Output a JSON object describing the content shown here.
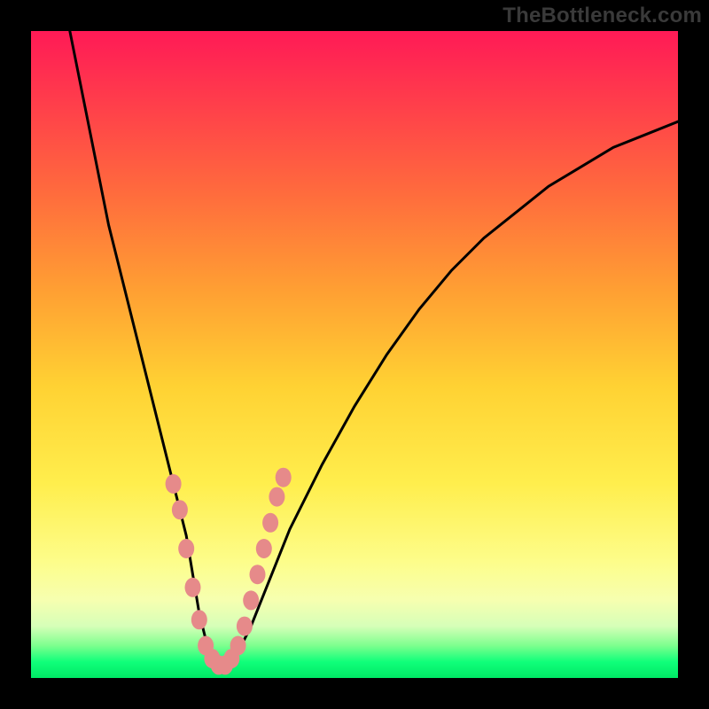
{
  "watermark": "TheBottleneck.com",
  "colors": {
    "background": "#000000",
    "curve": "#000000",
    "markers": "#e68a8a",
    "gradient_top": "#ff1a56",
    "gradient_bottom": "#00e865"
  },
  "chart_data": {
    "type": "line",
    "title": "",
    "xlabel": "",
    "ylabel": "",
    "xlim": [
      0,
      100
    ],
    "ylim": [
      0,
      100
    ],
    "grid": false,
    "legend": false,
    "note": "Axis values are relative percentages; image has no numeric tick labels.",
    "series": [
      {
        "name": "bottleneck-curve",
        "x": [
          6,
          8,
          10,
          12,
          15,
          18,
          20,
          22,
          24,
          25,
          26,
          27,
          28,
          29,
          30,
          32,
          34,
          36,
          38,
          40,
          45,
          50,
          55,
          60,
          65,
          70,
          75,
          80,
          85,
          90,
          95,
          100
        ],
        "values": [
          100,
          90,
          80,
          70,
          58,
          46,
          38,
          30,
          22,
          16,
          10,
          6,
          3,
          2,
          2,
          4,
          8,
          13,
          18,
          23,
          33,
          42,
          50,
          57,
          63,
          68,
          72,
          76,
          79,
          82,
          84,
          86
        ]
      }
    ],
    "markers": {
      "name": "highlight-dots",
      "points": [
        {
          "x": 22,
          "y": 30
        },
        {
          "x": 23,
          "y": 26
        },
        {
          "x": 24,
          "y": 20
        },
        {
          "x": 25,
          "y": 14
        },
        {
          "x": 26,
          "y": 9
        },
        {
          "x": 27,
          "y": 5
        },
        {
          "x": 28,
          "y": 3
        },
        {
          "x": 29,
          "y": 2
        },
        {
          "x": 30,
          "y": 2
        },
        {
          "x": 31,
          "y": 3
        },
        {
          "x": 32,
          "y": 5
        },
        {
          "x": 33,
          "y": 8
        },
        {
          "x": 34,
          "y": 12
        },
        {
          "x": 35,
          "y": 16
        },
        {
          "x": 36,
          "y": 20
        },
        {
          "x": 37,
          "y": 24
        },
        {
          "x": 38,
          "y": 28
        },
        {
          "x": 39,
          "y": 31
        }
      ]
    }
  }
}
